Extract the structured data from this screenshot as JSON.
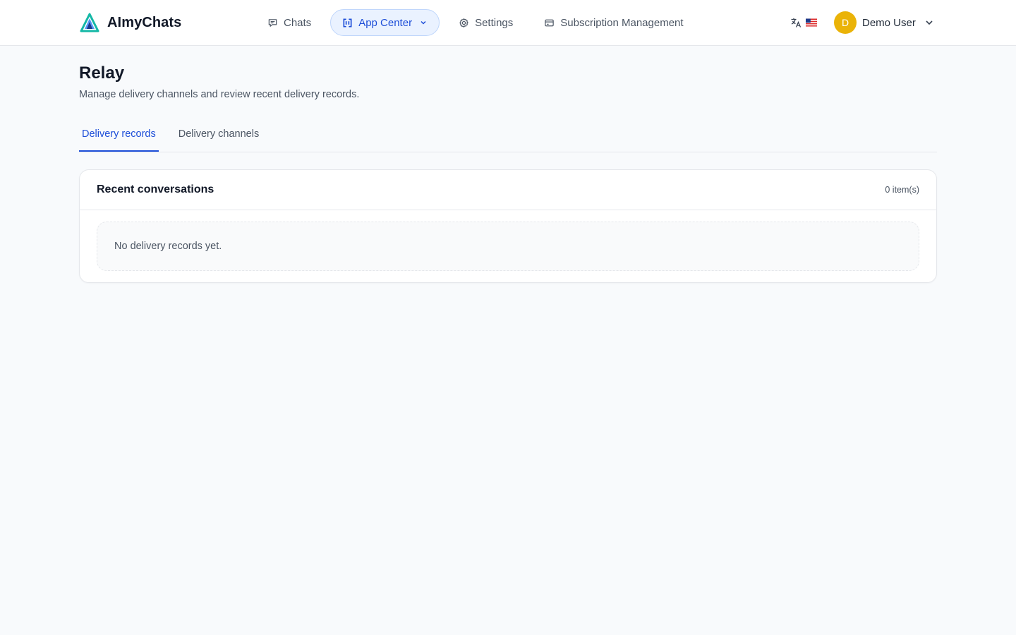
{
  "app": {
    "name": "AImyChats"
  },
  "nav": {
    "items": [
      {
        "label": "Chats",
        "icon": "chat-bubble-icon"
      },
      {
        "label": "App Center",
        "icon": "app-center-icon",
        "active": true
      },
      {
        "label": "Settings",
        "icon": "gear-icon"
      },
      {
        "label": "Subscription Management",
        "icon": "card-icon"
      }
    ]
  },
  "language": {
    "icon": "translate-icon",
    "flag": "us-flag-icon"
  },
  "user": {
    "initial": "D",
    "name": "Demo User",
    "avatar_color": "#eab308"
  },
  "page": {
    "title": "Relay",
    "subtitle": "Manage delivery channels and review recent delivery records."
  },
  "tabs": [
    {
      "label": "Delivery records",
      "active": true
    },
    {
      "label": "Delivery channels",
      "active": false
    }
  ],
  "recent": {
    "title": "Recent conversations",
    "count": "0 item(s)",
    "empty_text": "No delivery records yet."
  },
  "colors": {
    "accent": "#1d4ed8",
    "accent_bg": "#eaf2ff",
    "page_bg": "#f8fafc"
  }
}
